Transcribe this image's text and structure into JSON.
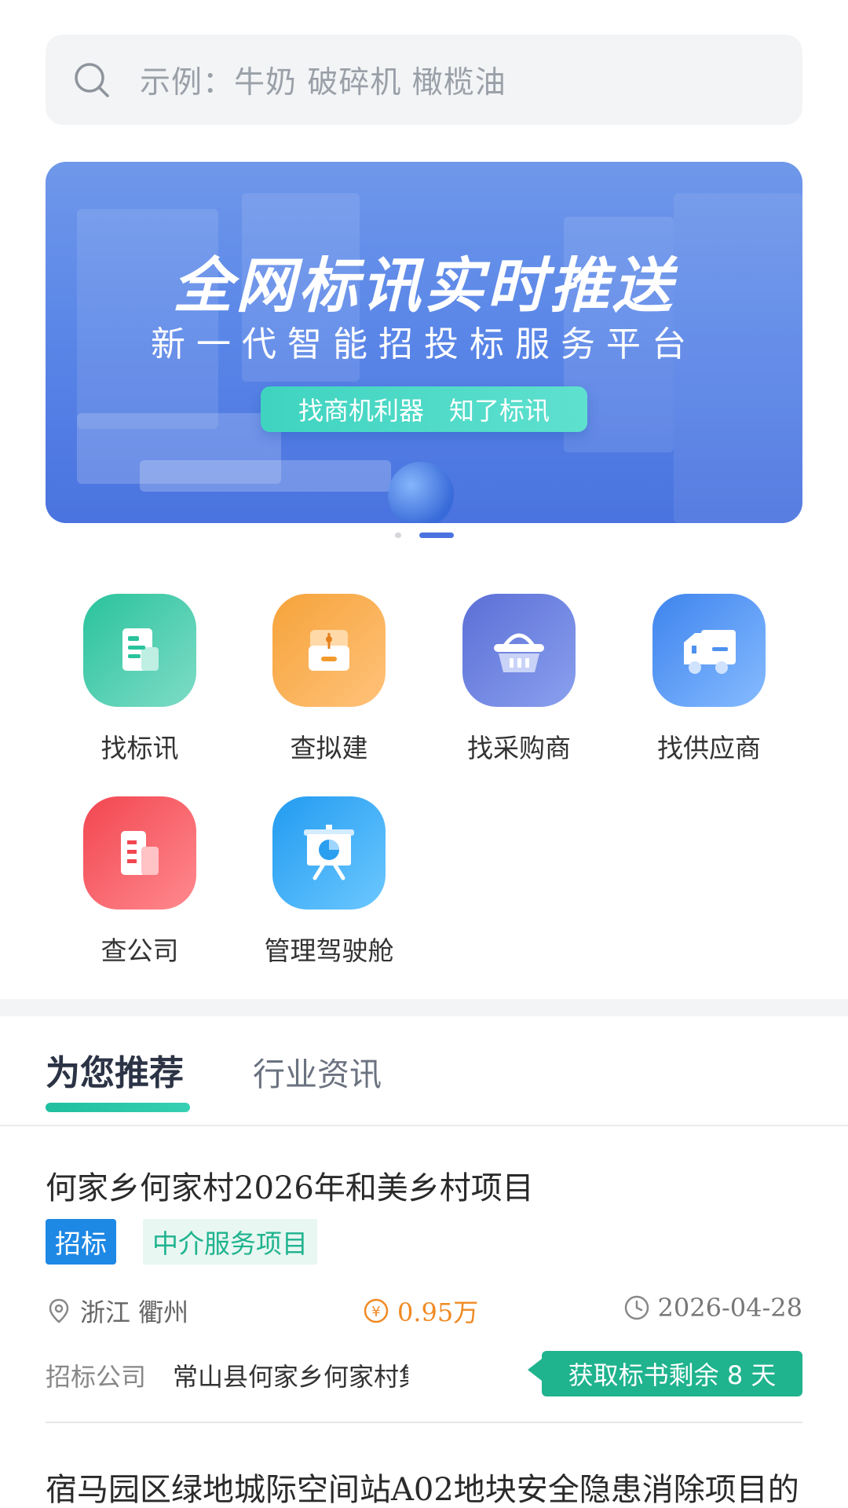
{
  "search": {
    "placeholder": "示例：牛奶 破碎机 橄榄油"
  },
  "banner": {
    "title": "全网标讯实时推送",
    "subtitle": "新一代智能招投标服务平台",
    "pill": "找商机利器　知了标讯"
  },
  "menu": [
    {
      "label": "找标讯",
      "icon": "document-icon",
      "color": "#2cc3a0"
    },
    {
      "label": "查拟建",
      "icon": "archive-box-icon",
      "color": "#f6a03a"
    },
    {
      "label": "找采购商",
      "icon": "basket-icon",
      "color": "#5a74d8"
    },
    {
      "label": "找供应商",
      "icon": "truck-icon",
      "color": "#4a8ff0"
    },
    {
      "label": "查公司",
      "icon": "building-icon",
      "color": "#f24f57"
    },
    {
      "label": "管理驾驶舱",
      "icon": "presentation-chart-icon",
      "color": "#2ea8f5"
    }
  ],
  "tabs": [
    {
      "label": "为您推荐",
      "active": true
    },
    {
      "label": "行业资讯",
      "active": false
    }
  ],
  "feed": [
    {
      "title": "何家乡何家村2026年和美乡村项目",
      "tag_type": "招标",
      "tag_category": "中介服务项目",
      "location": "浙江 衢州",
      "amount": "0.95万",
      "date": "2026-04-28",
      "company_label": "招标公司",
      "company": "常山县何家乡何家村集体经济",
      "deadline": "获取标书剩余 8 天"
    },
    {
      "title": "宿马园区绿地城际空间站A02地块安全隐患消除项目的"
    }
  ]
}
